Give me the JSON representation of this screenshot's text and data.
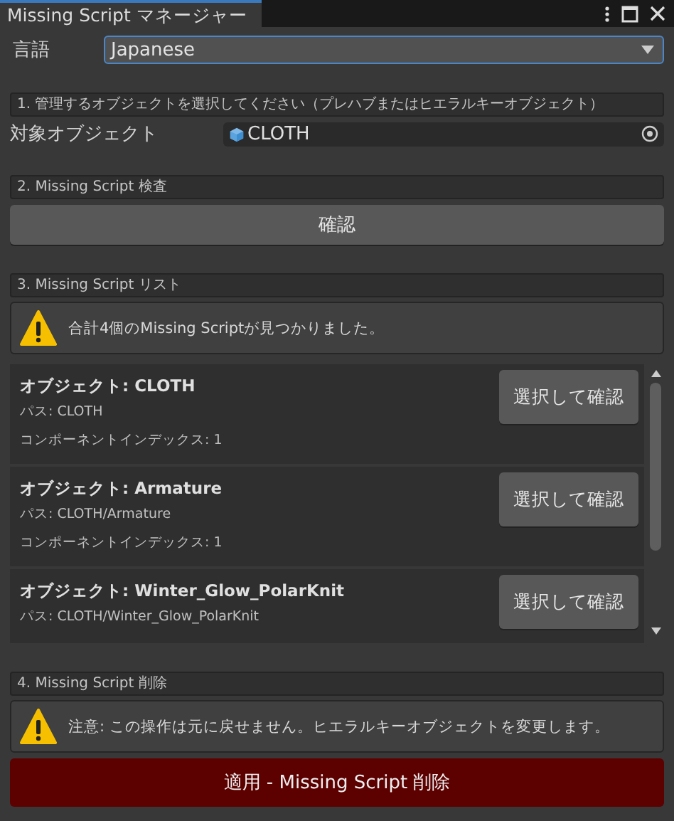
{
  "window": {
    "tab_title": "Missing Script マネージャー"
  },
  "language": {
    "label": "言語",
    "value": "Japanese"
  },
  "sections": [
    {
      "kind": "target",
      "header": "1. 管理するオブジェクトを選択してください（プレハブまたはヒエラルキーオブジェクト）",
      "field_label": "対象オブジェクト",
      "field_value": "CLOTH"
    },
    {
      "kind": "check",
      "header": "2. Missing Script 検査",
      "button": "確認"
    },
    {
      "kind": "list",
      "header": "3. Missing Script リスト",
      "message": "合計4個のMissing Scriptが見つかりました。",
      "items": [
        {
          "object": "オブジェクト: CLOTH",
          "path": "パス: CLOTH",
          "index": "コンポーネントインデックス: 1",
          "button": "選択して確認"
        },
        {
          "object": "オブジェクト: Armature",
          "path": "パス: CLOTH/Armature",
          "index": "コンポーネントインデックス: 1",
          "button": "選択して確認"
        },
        {
          "object": "オブジェクト: Winter_Glow_PolarKnit",
          "path": "パス: CLOTH/Winter_Glow_PolarKnit",
          "button": "選択して確認"
        }
      ]
    },
    {
      "kind": "delete",
      "header": "4. Missing Script 削除",
      "message": "注意: この操作は元に戻せません。ヒエラルキーオブジェクトを変更します。",
      "button": "適用 - Missing Script 削除"
    }
  ]
}
